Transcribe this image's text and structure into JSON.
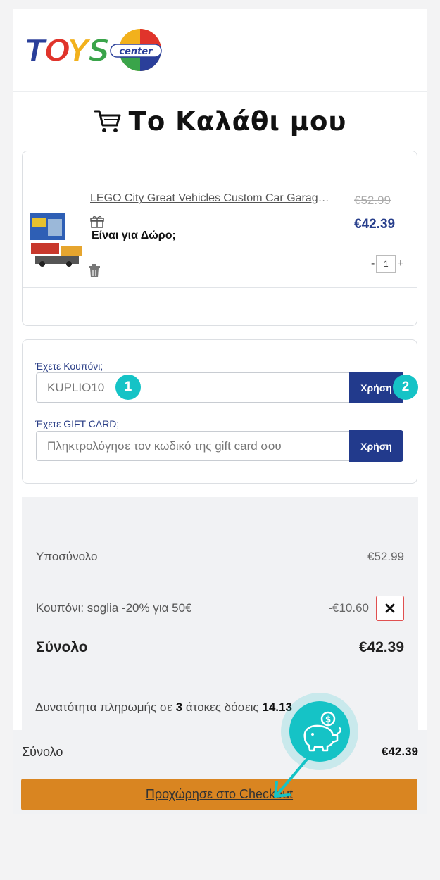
{
  "header": {
    "logo_text": "TOYS center"
  },
  "page": {
    "title": "Το Καλάθι μου"
  },
  "cart_item": {
    "name": "LEGO City Great Vehicles Custom Car Garage...",
    "old_price": "€52.99",
    "new_price": "€42.39",
    "gift_label": "Είναι για Δώρο;",
    "quantity": "1",
    "qty_minus": "-",
    "qty_plus": "+"
  },
  "coupon": {
    "label": "Έχετε Κουπόνι;",
    "value": "KUPLIO10",
    "apply_label": "Χρήση",
    "badge": "1",
    "apply_badge": "2"
  },
  "gift_card": {
    "label": "Έχετε GIFT CARD;",
    "placeholder": "Πληκτρολόγησε τον κωδικό της gift card σου",
    "apply_label": "Χρήση"
  },
  "summary": {
    "subtotal_label": "Υποσύνολο",
    "subtotal_value": "€52.99",
    "coupon_label": "Κουπόνι: soglia -20% για 50€",
    "coupon_value": "-€10.60",
    "total_label": "Σύνολο",
    "total_value": "€42.39",
    "installments_prefix": "Δυνατότητα πληρωμής σε",
    "installments_count": "3",
    "installments_suffix": "άτοκες δόσεις",
    "installments_amount": "14.13"
  },
  "sticky": {
    "total_label": "Σύνολο",
    "total_value": "€42.39",
    "checkout_label": "Προχώρησε στο Checkout"
  },
  "colors": {
    "primary": "#223a8c",
    "accent": "#d98521",
    "highlight": "#15c3c6",
    "remove": "#e05050"
  },
  "icons": [
    "cart-icon",
    "gift-icon",
    "trash-icon",
    "close-icon",
    "piggy-bank-icon",
    "arrow-icon"
  ]
}
